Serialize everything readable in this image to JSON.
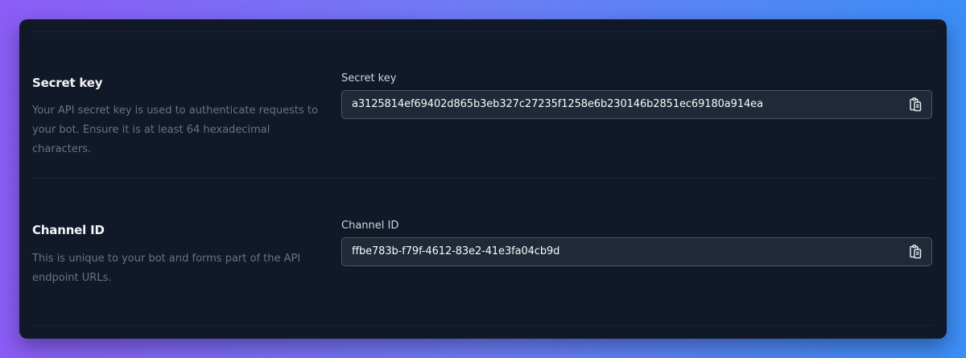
{
  "secret_key_section": {
    "title": "Secret key",
    "description": "Your API secret key is used to authenticate requests to your bot. Ensure it is at least 64 hexadecimal characters.",
    "field_label": "Secret key",
    "field_value": "a3125814ef69402d865b3eb327c27235f1258e6b230146b2851ec69180a914ea",
    "copy_icon": "clipboard-copy-icon"
  },
  "channel_id_section": {
    "title": "Channel ID",
    "description": "This is unique to your bot and forms part of the API endpoint URLs.",
    "field_label": "Channel ID",
    "field_value": "ffbe783b-f79f-4612-83e2-41e3fa04cb9d",
    "copy_icon": "clipboard-copy-icon"
  },
  "colors": {
    "panel_background": "#111827",
    "input_background": "#1f2937",
    "input_border": "#4b5563",
    "gradient_start": "#8b5cf6",
    "gradient_end": "#3b8ef6"
  }
}
